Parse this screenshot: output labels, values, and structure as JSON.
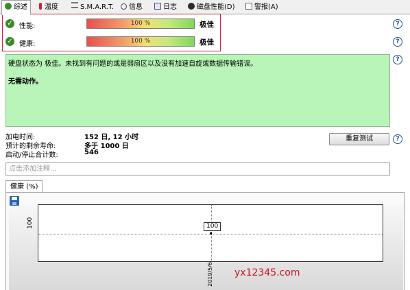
{
  "tabs": [
    {
      "label": "综述",
      "icon": "overview-check-icon",
      "active": true
    },
    {
      "label": "温度",
      "icon": "thermometer-icon"
    },
    {
      "label": "S.M.A.R.T.",
      "icon": "smart-icon"
    },
    {
      "label": "信息",
      "icon": "info-icon"
    },
    {
      "label": "日志",
      "icon": "log-icon"
    },
    {
      "label": "磁盘性能(D)",
      "icon": "disk-performance-icon"
    },
    {
      "label": "警报(A)",
      "icon": "alert-icon"
    }
  ],
  "status": {
    "performance": {
      "label": "性能:",
      "percent_text": "100 %",
      "percent": 100,
      "rating": "极佳"
    },
    "health": {
      "label": "健康:",
      "percent_text": "100 %",
      "percent": 100,
      "rating": "极佳"
    }
  },
  "message": {
    "line1": "硬盘状态为 极佳。未找到有问题的或是弱扇区以及没有加速自旋或数据传输错误。",
    "line2": "无需动作。"
  },
  "info": {
    "power_on_label": "加电时间:",
    "power_on_value": "152 日, 12 小时",
    "lifetime_label": "预计的剩余寿命:",
    "lifetime_value": "多于 1000 日",
    "startstop_label": "启动/停止合计数:",
    "startstop_value": "546"
  },
  "retest_button": "重复测试",
  "notes_placeholder": "点击添加注释...",
  "chart_tab_label": "健康 (%)",
  "chart_data": {
    "type": "scatter",
    "x": [
      "2019/5/6"
    ],
    "y": [
      100
    ],
    "point_labels": [
      "100"
    ],
    "ylabel": "",
    "xlabel": ""
  },
  "watermark": "yx12345.com",
  "colors": {
    "accent_red": "#cc2233",
    "message_bg": "#b9f5b9",
    "ok_green": "#3a8a2a"
  }
}
